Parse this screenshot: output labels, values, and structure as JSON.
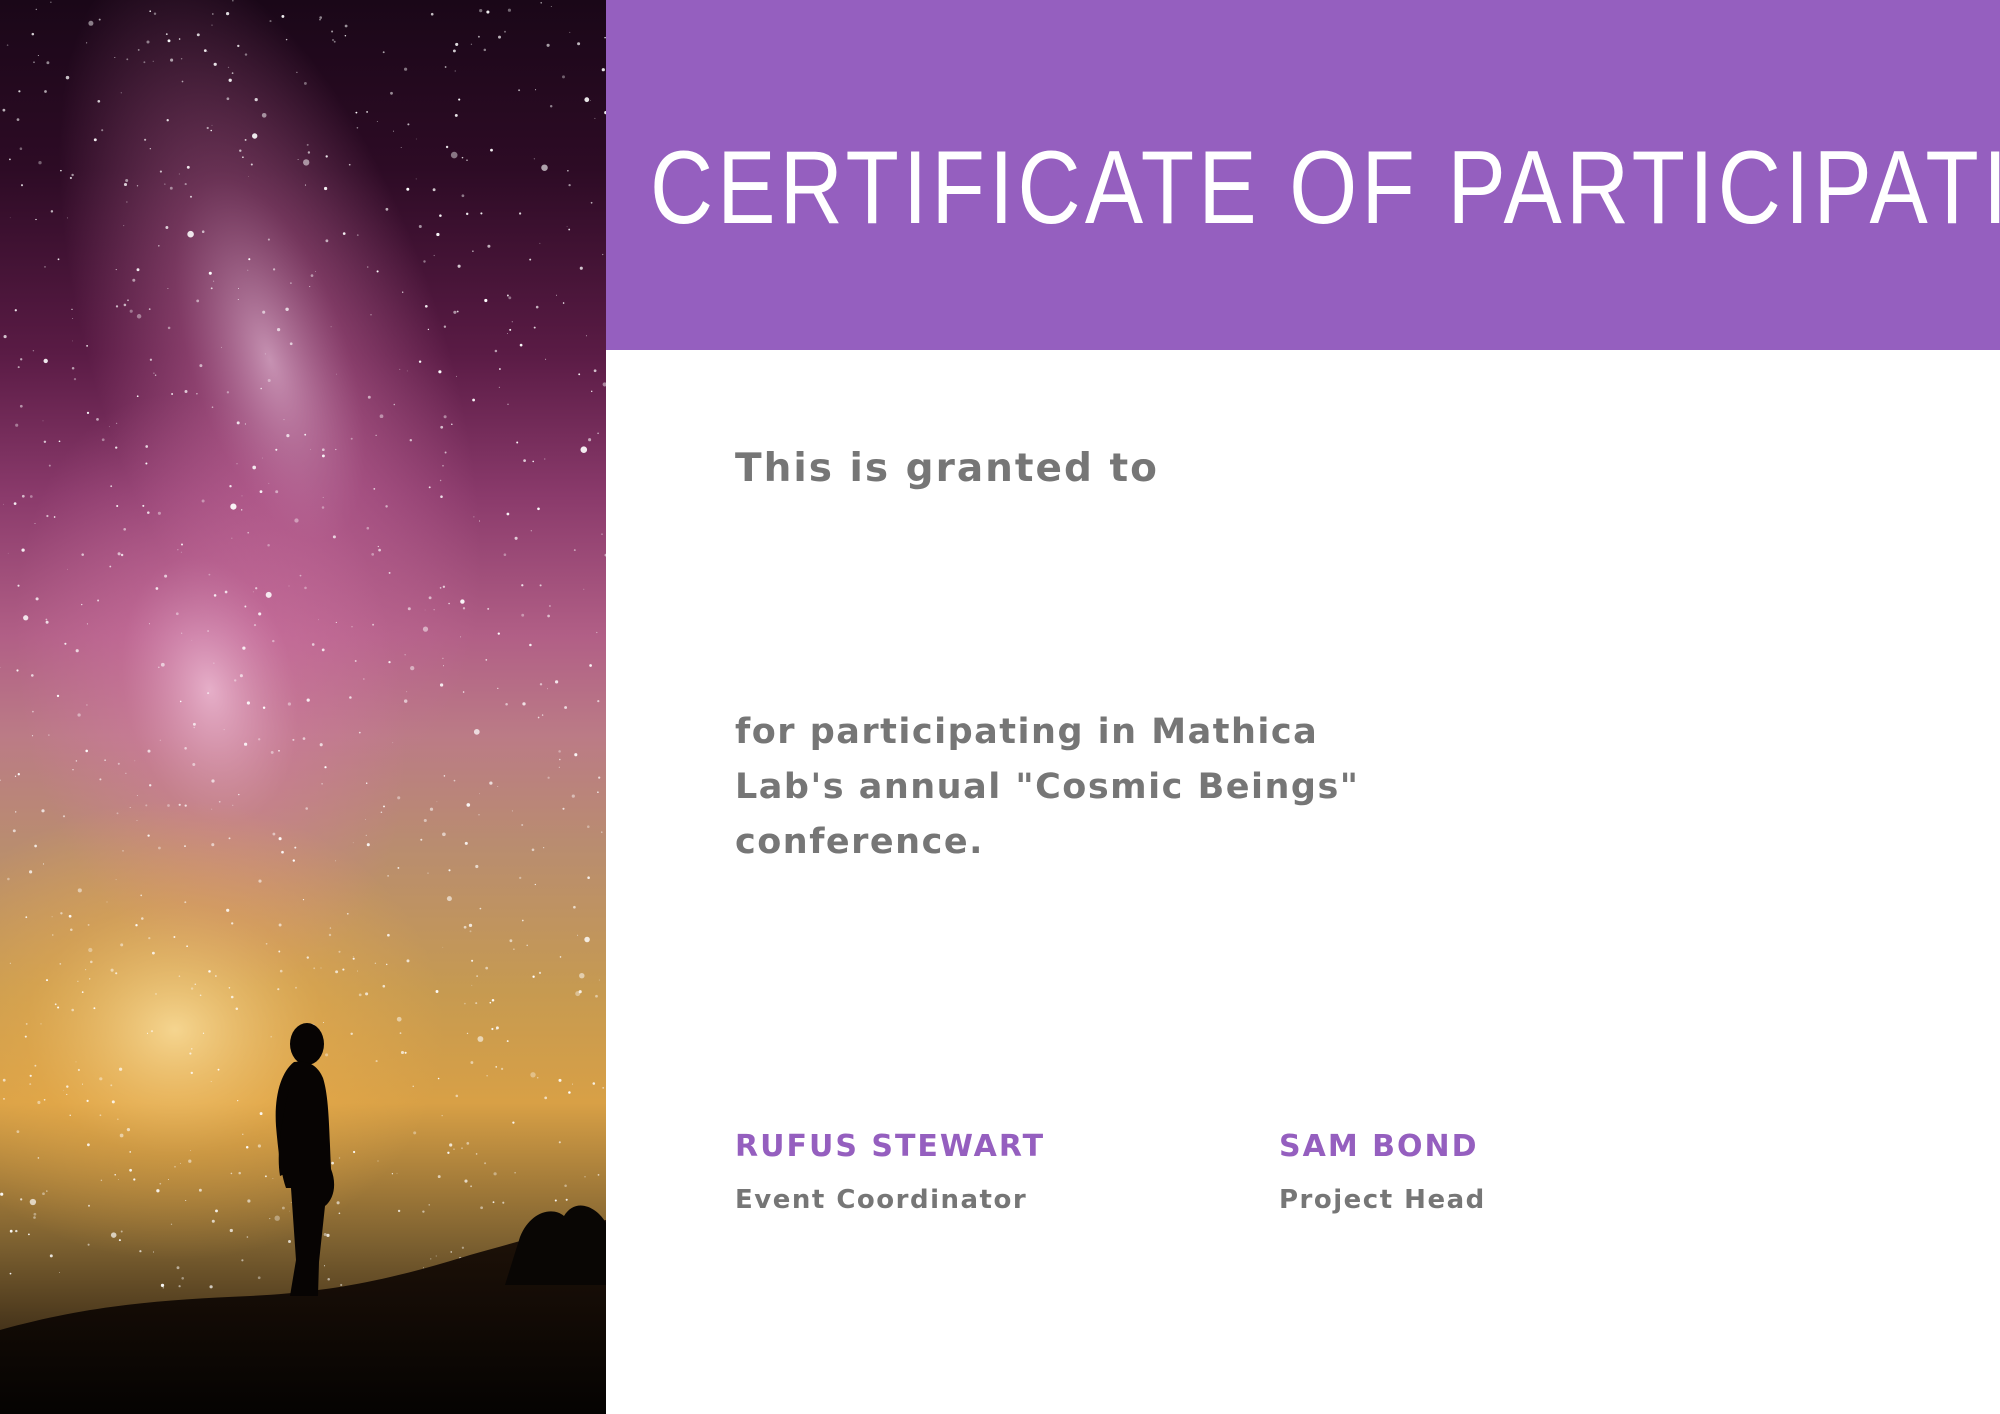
{
  "certificate": {
    "title": "CERTIFICATE OF PARTICIPATION",
    "granted_text": "This is granted to",
    "description": "for participating in Mathica\nLab's annual \"Cosmic Beings\"\nconference.",
    "signatories": [
      {
        "name": "RUFUS STEWART",
        "role": "Event Coordinator"
      },
      {
        "name": "SAM BOND",
        "role": "Project Head"
      }
    ]
  },
  "colors": {
    "header": "#955fbf",
    "body_text": "#767676",
    "accent": "#955fbf",
    "background": "#ffffff"
  },
  "image": {
    "subject": "starry-night-sky-with-silhouetted-person"
  }
}
